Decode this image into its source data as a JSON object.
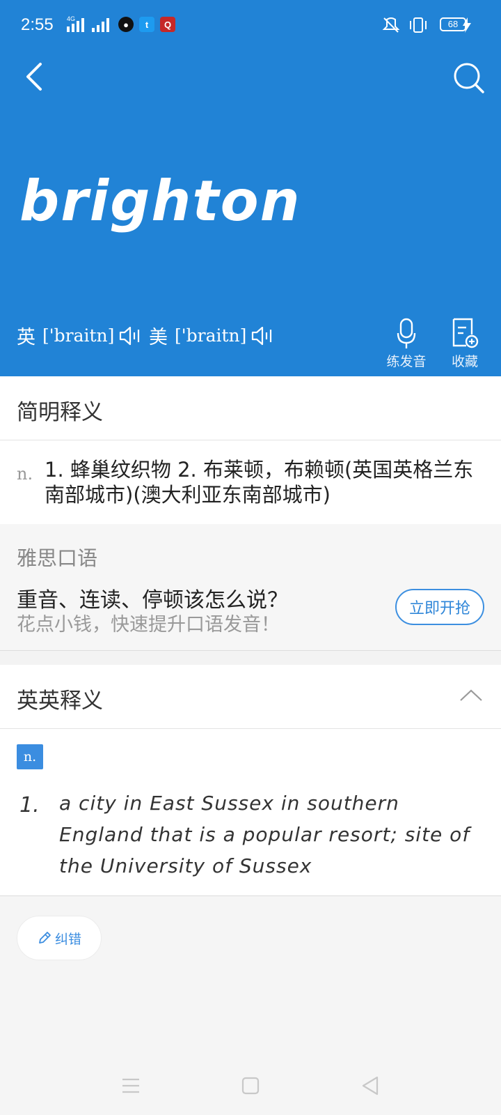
{
  "status_bar": {
    "time": "2:55",
    "network": "4G",
    "battery": "68"
  },
  "header": {
    "word": "brighton",
    "pronunciations": [
      {
        "region": "英",
        "ipa": "['braitn]"
      },
      {
        "region": "美",
        "ipa": "['braitn]"
      }
    ],
    "practice_label": "练发音",
    "favorite_label": "收藏"
  },
  "brief": {
    "title": "简明释义",
    "pos": "n.",
    "definition": "1. 蜂巢纹织物  2. 布莱顿，布赖顿(英国英格兰东南部城市)(澳大利亚东南部城市)"
  },
  "promo": {
    "title": "雅思口语",
    "headline": "重音、连读、停顿该怎么说？",
    "subline": "花点小钱，快速提升口语发音！",
    "cta": "立即开抢"
  },
  "en_en": {
    "title": "英英释义",
    "pos": "n.",
    "items": [
      {
        "num": "1.",
        "text": "a city in East Sussex in southern England that is a popular resort; site of the University of Sussex"
      }
    ]
  },
  "report_error_label": "纠错",
  "colors": {
    "header_bg": "#2183d6",
    "accent": "#3b8de0"
  }
}
